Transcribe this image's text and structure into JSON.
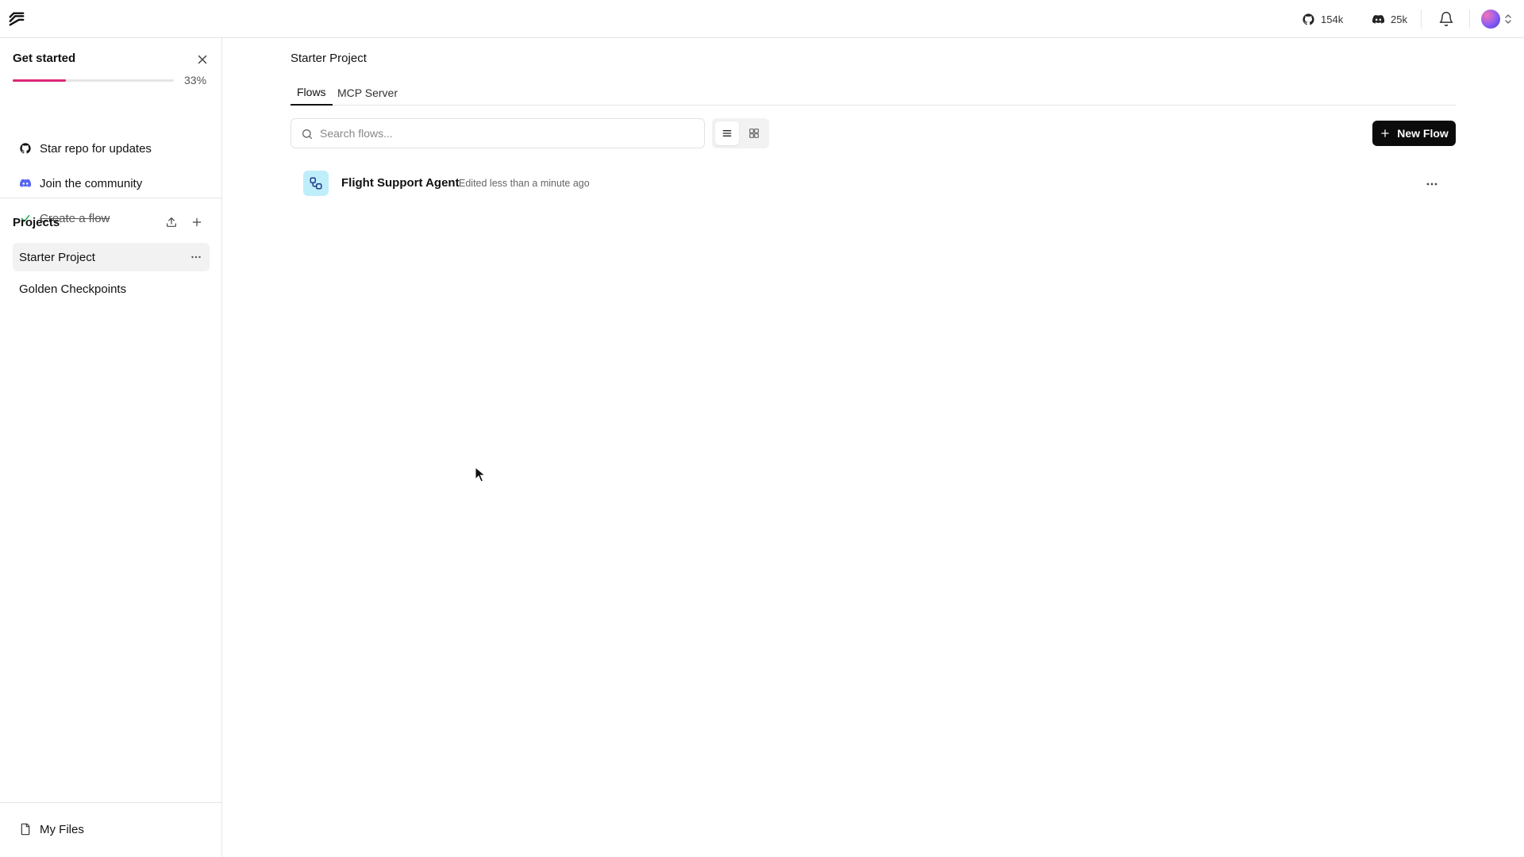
{
  "header": {
    "logo_icon": "langflow-logo-icon",
    "github_stars": "154k",
    "discord_members": "25k",
    "bell_icon": "bell-icon"
  },
  "get_started": {
    "title": "Get started",
    "progress_percent_label": "33%",
    "progress_fraction": 0.33,
    "accent_color": "#db2777",
    "items": [
      {
        "label": "Star repo for updates",
        "icon": "github-icon",
        "done": false
      },
      {
        "label": "Join the community",
        "icon": "discord-icon",
        "done": false
      },
      {
        "label": "Create a flow",
        "icon": "check-icon",
        "done": true
      }
    ]
  },
  "projects": {
    "title": "Projects",
    "items": [
      {
        "label": "Starter Project",
        "active": true
      },
      {
        "label": "Golden Checkpoints",
        "active": false
      }
    ]
  },
  "sidebar_footer": {
    "my_files_label": "My Files"
  },
  "main": {
    "title": "Starter Project",
    "tabs": [
      {
        "label": "Flows",
        "active": true
      },
      {
        "label": "MCP Server",
        "active": false
      }
    ],
    "search": {
      "placeholder": "Search flows...",
      "value": ""
    },
    "view_mode": "list",
    "new_flow_label": "New Flow",
    "flows": [
      {
        "name": "Flight Support Agent",
        "meta": "Edited less than a minute ago",
        "icon_bg": "#bfeefb"
      }
    ]
  }
}
